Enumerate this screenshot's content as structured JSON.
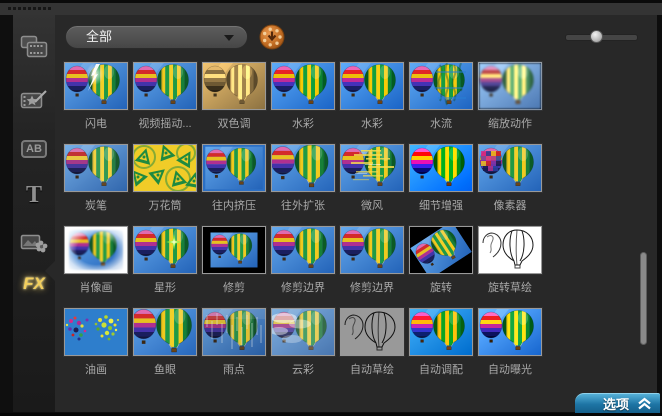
{
  "sidebar": {
    "items": [
      {
        "icon": "media-library-icon",
        "label": ""
      },
      {
        "icon": "transition-icon",
        "label": ""
      },
      {
        "icon": "overlay-ab-icon",
        "label": "AB"
      },
      {
        "icon": "title-text-icon",
        "label": "T"
      },
      {
        "icon": "graphic-icon",
        "label": ""
      },
      {
        "icon": "fx-filter-icon",
        "label": "FX",
        "active": true
      }
    ]
  },
  "toolbar": {
    "gallery_dropdown": {
      "value": "全部",
      "caret_icon": "chevron-down-icon"
    },
    "download_icon": "film-reel-download-icon",
    "zoom_slider": {
      "position_percent": 42
    }
  },
  "grid": {
    "items": [
      {
        "label": "闪电"
      },
      {
        "label": "视频摇动..."
      },
      {
        "label": "双色调"
      },
      {
        "label": "水彩"
      },
      {
        "label": "水彩"
      },
      {
        "label": "水流"
      },
      {
        "label": "缩放动作"
      },
      {
        "label": "炭笔"
      },
      {
        "label": "万花筒"
      },
      {
        "label": "往内挤压"
      },
      {
        "label": "往外扩张"
      },
      {
        "label": "微风"
      },
      {
        "label": "细节增强"
      },
      {
        "label": "像素器"
      },
      {
        "label": "肖像画"
      },
      {
        "label": "星形"
      },
      {
        "label": "修剪"
      },
      {
        "label": "修剪边界"
      },
      {
        "label": "修剪边界"
      },
      {
        "label": "旋转"
      },
      {
        "label": "旋转草绘"
      },
      {
        "label": "油画"
      },
      {
        "label": "鱼眼"
      },
      {
        "label": "雨点"
      },
      {
        "label": "云彩"
      },
      {
        "label": "自动草绘"
      },
      {
        "label": "自动调配"
      },
      {
        "label": "自动曝光"
      }
    ]
  },
  "footer": {
    "options_button": "选项",
    "collapse_icon": "double-chevron-up-icon"
  },
  "colors": {
    "accent_blue": "#1d74a4",
    "fx_gold": "#f2cf5e",
    "sky_blue": "#2b6fc4",
    "download_orange": "#c06a20"
  }
}
